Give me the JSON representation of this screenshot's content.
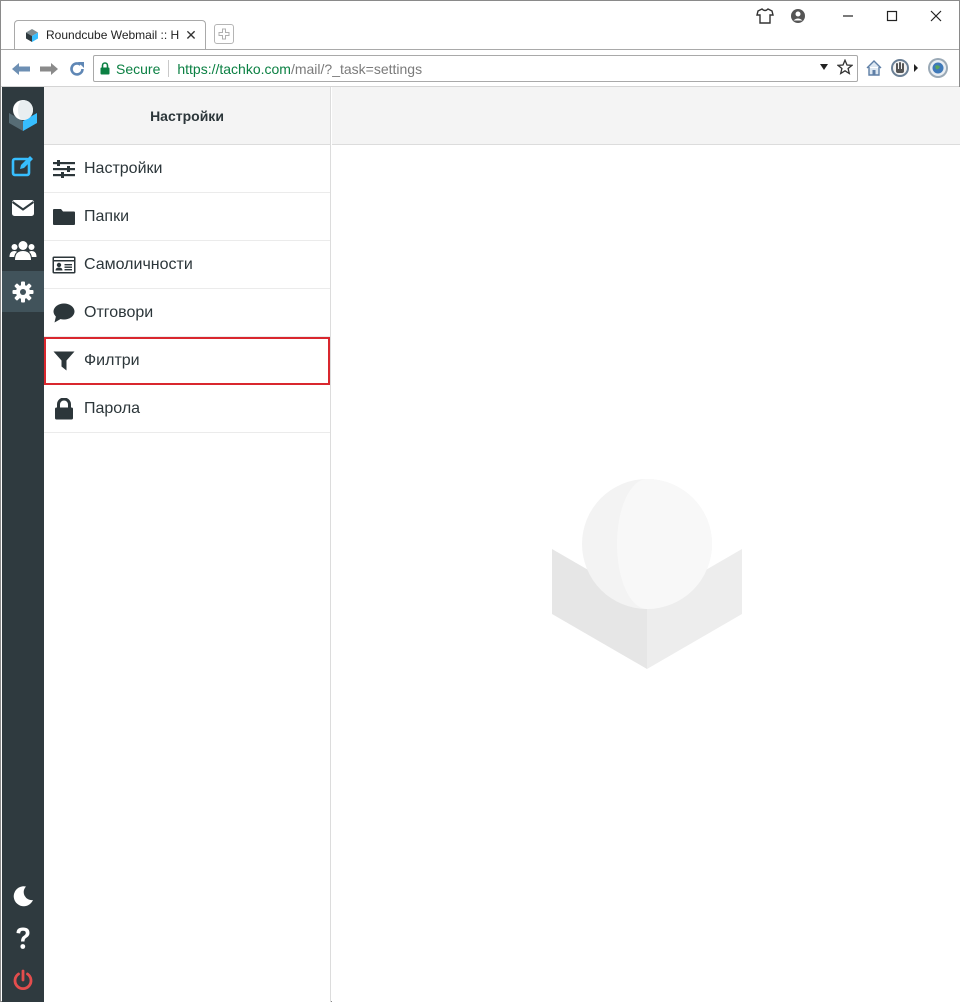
{
  "browser": {
    "tab_title": "Roundcube Webmail :: H",
    "secure_label": "Secure",
    "url_main": "https://tachko.com",
    "url_rest": "/mail/?_task=settings"
  },
  "sidebar": {
    "items": [
      {
        "name": "compose",
        "icon": "compose-icon",
        "color": "#37beff"
      },
      {
        "name": "mail",
        "icon": "envelope-icon",
        "color": "#ffffff"
      },
      {
        "name": "contacts",
        "icon": "users-icon",
        "color": "#ffffff"
      },
      {
        "name": "settings",
        "icon": "gear-icon",
        "color": "#ffffff",
        "active": true
      }
    ],
    "bottom": [
      {
        "name": "dark-mode",
        "icon": "moon-icon"
      },
      {
        "name": "help",
        "icon": "question-icon"
      },
      {
        "name": "logout",
        "icon": "power-icon",
        "color": "#e44d4d"
      }
    ]
  },
  "settings_panel": {
    "title": "Настройки",
    "items": [
      {
        "label": "Настройки",
        "icon": "sliders-icon"
      },
      {
        "label": "Папки",
        "icon": "folder-icon"
      },
      {
        "label": "Самоличности",
        "icon": "id-card-icon"
      },
      {
        "label": "Отговори",
        "icon": "comment-icon"
      },
      {
        "label": "Филтри",
        "icon": "filter-icon",
        "highlighted": true
      },
      {
        "label": "Парола",
        "icon": "lock-icon"
      }
    ]
  },
  "colors": {
    "sidebar_bg": "#2f3a3f",
    "accent": "#37beff",
    "highlight_border": "#d9272e",
    "secure_green": "#0b8043"
  }
}
